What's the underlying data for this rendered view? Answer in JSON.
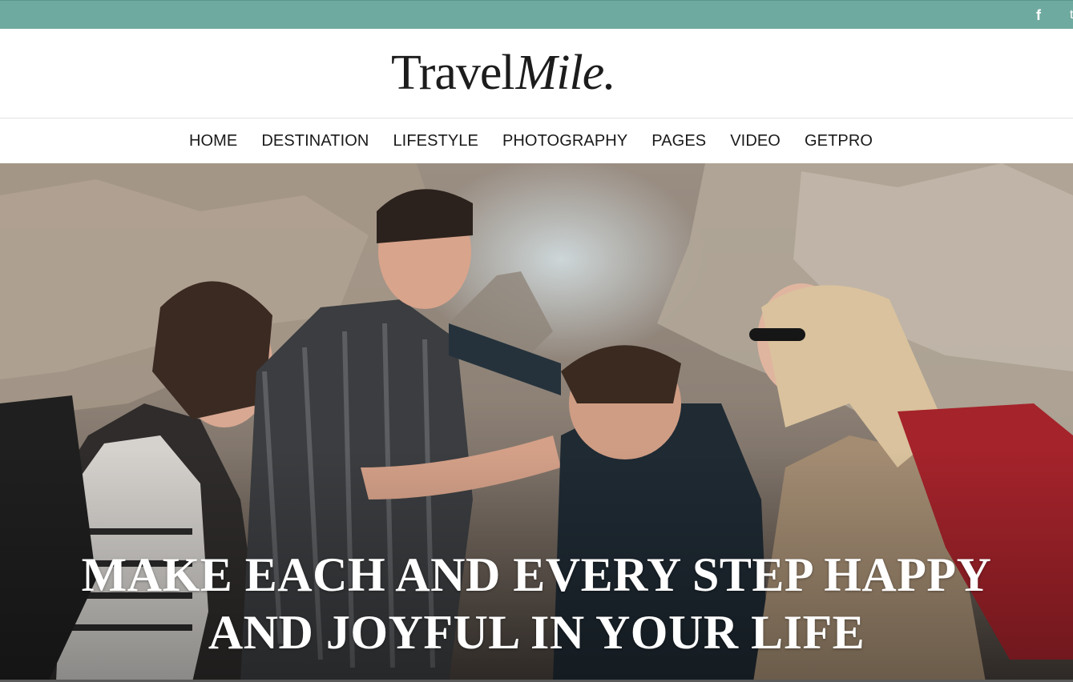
{
  "topbar": {
    "social_icons": [
      {
        "icon": "facebook-icon",
        "glyph": "f"
      },
      {
        "icon": "twitter-icon",
        "glyph": "t"
      }
    ],
    "background": "#6faaa0"
  },
  "header": {
    "logo_part1": "Travel",
    "logo_part2": "Mile."
  },
  "nav": {
    "items": [
      "HOME",
      "DESTINATION",
      "LIFESTYLE",
      "PHOTOGRAPHY",
      "PAGES",
      "VIDEO",
      "GETPRO"
    ]
  },
  "hero": {
    "title_line1": "MAKE EACH AND EVERY STEP HAPPY",
    "title_line2": "AND JOYFUL IN YOUR LIFE",
    "image_subject": "four-hikers-laughing-photo"
  }
}
